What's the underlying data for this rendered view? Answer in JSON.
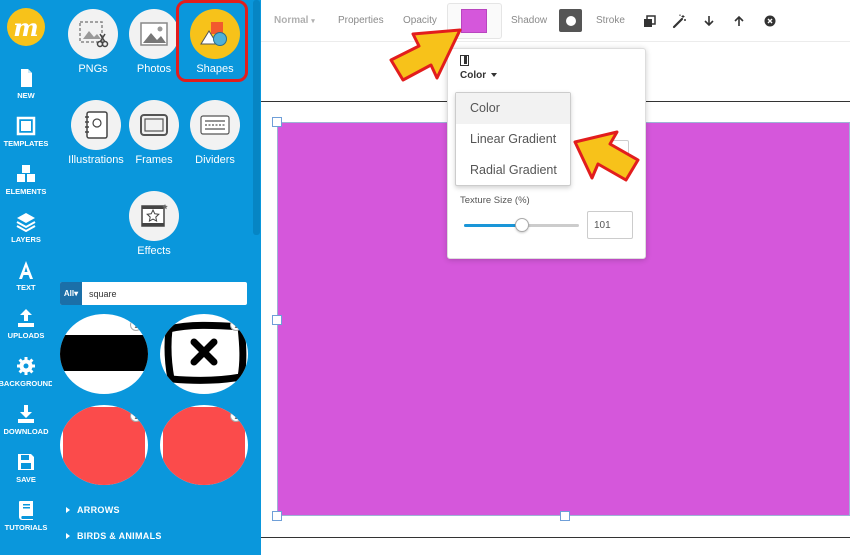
{
  "rail": {
    "items": [
      {
        "label": "NEW",
        "icon": "new-file-icon"
      },
      {
        "label": "TEMPLATES",
        "icon": "templates-icon"
      },
      {
        "label": "ELEMENTS",
        "icon": "elements-icon"
      },
      {
        "label": "LAYERS",
        "icon": "layers-icon"
      },
      {
        "label": "TEXT",
        "icon": "text-icon"
      },
      {
        "label": "UPLOADS",
        "icon": "upload-icon"
      },
      {
        "label": "BACKGROUND",
        "icon": "gear-icon"
      },
      {
        "label": "DOWNLOAD",
        "icon": "download-icon"
      },
      {
        "label": "SAVE",
        "icon": "save-icon"
      },
      {
        "label": "TUTORIALS",
        "icon": "book-icon"
      }
    ]
  },
  "panel": {
    "categories": [
      {
        "label": "PNGs"
      },
      {
        "label": "Photos"
      },
      {
        "label": "Shapes"
      },
      {
        "label": "Illustrations"
      },
      {
        "label": "Frames"
      },
      {
        "label": "Dividers"
      },
      {
        "label": "Effects"
      }
    ],
    "selected_category": "Shapes",
    "search": {
      "filter": "All",
      "query": "square"
    },
    "links": [
      "ARROWS",
      "BIRDS & ANIMALS"
    ]
  },
  "toolbar": {
    "blend": "Normal",
    "properties": "Properties",
    "opacity": "Opacity",
    "shadow": "Shadow",
    "stroke": "Stroke",
    "fill_color": "#d557db"
  },
  "popover": {
    "fill_type": "Color",
    "options": [
      "Color",
      "Linear Gradient",
      "Radial Gradient"
    ],
    "texture_label": "Texture Size (%)",
    "texture_value": "101",
    "slider_fraction": 0.5
  },
  "colors": {
    "accent": "#0a97dc",
    "shape_fill": "#d557db",
    "highlight": "#e21d1d",
    "arrow": "#f7c21a"
  }
}
